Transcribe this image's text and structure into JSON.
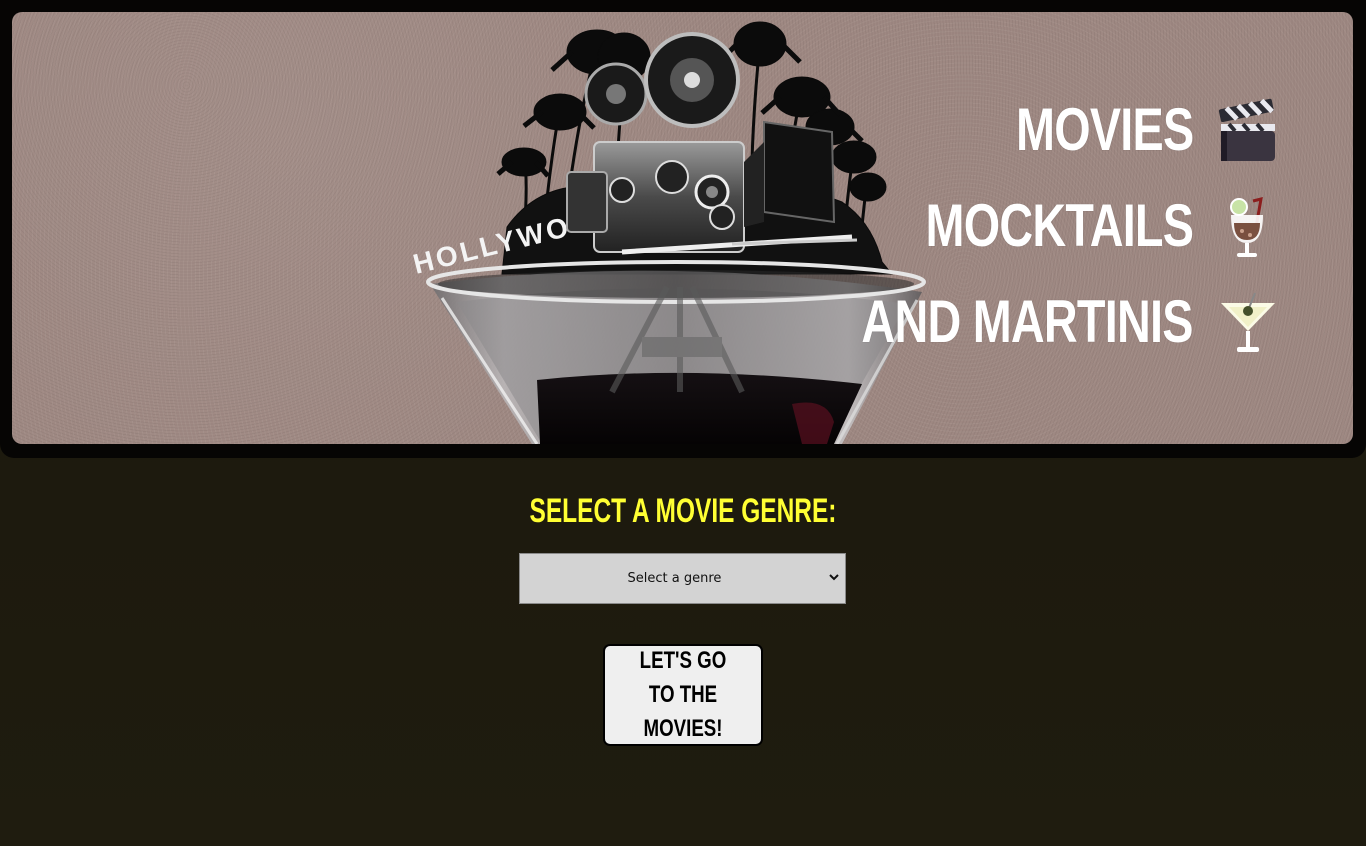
{
  "hero": {
    "sign_text": "HOLLYWOOD",
    "titles": [
      {
        "label": "MOVIES",
        "icon": "clapperboard-icon"
      },
      {
        "label": "MOCKTAILS",
        "icon": "mocktail-glass-icon"
      },
      {
        "label": "AND MARTINIS",
        "icon": "martini-glass-icon"
      }
    ]
  },
  "genre": {
    "heading": "SELECT A MOVIE GENRE:",
    "selected": "Select a genre"
  },
  "action": {
    "go_label": "LET'S GO TO THE MOVIES!"
  },
  "colors": {
    "page_background": "#1c1a0f",
    "hero_background": "#9e8882",
    "heading_accent": "#ffff33",
    "button_background": "#efefef"
  }
}
